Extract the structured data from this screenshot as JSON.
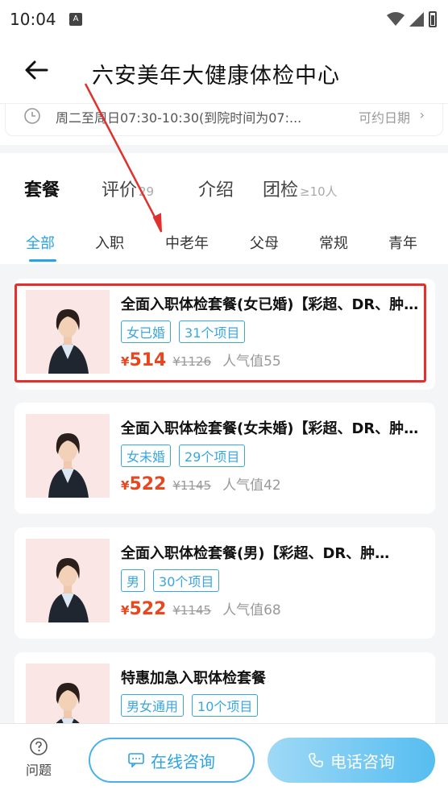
{
  "status_bar": {
    "time": "10:04",
    "app_icon_text": "A"
  },
  "header": {
    "back_icon": "arrow-left",
    "title": "六安美年大健康体检中心"
  },
  "hours": {
    "text": "周二至周日07:30-10:30(到院时间为07:...",
    "link": "可约日期",
    "chevron": "›"
  },
  "main_tabs": [
    {
      "label": "套餐",
      "count": ""
    },
    {
      "label": "评价",
      "count": "29"
    },
    {
      "label": "介绍",
      "count": ""
    },
    {
      "label": "团检",
      "count": "≥10人"
    }
  ],
  "sub_tabs": [
    "全部",
    "入职",
    "中老年",
    "父母",
    "常规",
    "青年"
  ],
  "packages": [
    {
      "title": "全面入职体检套餐(女已婚)【彩超、DR、肿瘤...",
      "tags": [
        "女已婚",
        "31个项目"
      ],
      "currency": "¥",
      "price": "514",
      "original": "¥1126",
      "popularity": "人气值55"
    },
    {
      "title": "全面入职体检套餐(女未婚)【彩超、DR、肿瘤...",
      "tags": [
        "女未婚",
        "29个项目"
      ],
      "currency": "¥",
      "price": "522",
      "original": "¥1145",
      "popularity": "人气值42"
    },
    {
      "title": "全面入职体检套餐(男)【彩超、DR、肿…",
      "tags": [
        "男",
        "30个项目"
      ],
      "currency": "¥",
      "price": "522",
      "original": "¥1145",
      "popularity": "人气值68"
    },
    {
      "title": "特惠加急入职体检套餐",
      "tags": [
        "男女通用",
        "10个项目"
      ],
      "currency": "",
      "price": "",
      "original": "",
      "popularity": ""
    }
  ],
  "bottom_bar": {
    "help_label": "问题",
    "online_label": "在线咨询",
    "phone_label": "电话咨询"
  },
  "colors": {
    "accent": "#2aa3e2",
    "price": "#e8461f",
    "highlight": "#e0312e"
  }
}
